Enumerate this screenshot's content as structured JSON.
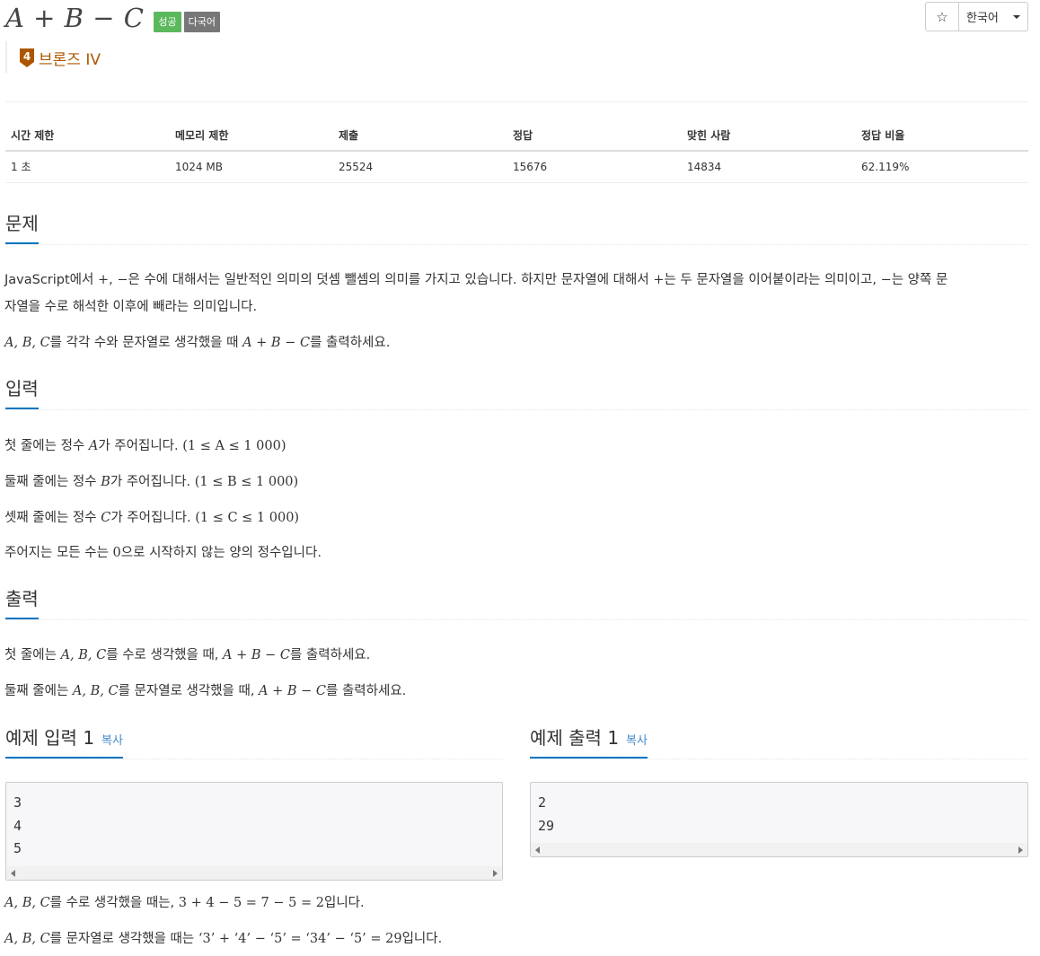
{
  "header": {
    "title": "A + B − C",
    "badges": [
      "성공",
      "다국어"
    ],
    "star_icon": "☆",
    "language": "한국어",
    "tier_number": "4",
    "tier_label": "브론즈 IV",
    "tier_color": "#ad5600"
  },
  "info": {
    "headers": [
      "시간 제한",
      "메모리 제한",
      "제출",
      "정답",
      "맞힌 사람",
      "정답 비율"
    ],
    "values": [
      "1 초",
      "1024 MB",
      "25524",
      "15676",
      "14834",
      "62.119%"
    ]
  },
  "problem": {
    "heading": "문제",
    "p1_a": "JavaScript에서 ",
    "p1_plus": "+",
    "p1_b": ", ",
    "p1_minus": "−",
    "p1_c": "은 수에 대해서는 일반적인 의미의 덧셈 뺄셈의 의미를 가지고 있습니다. 하지만 문자열에 대해서 ",
    "p1_plus2": "+",
    "p1_d": "는 두 문자열을 이어붙이라는 의미이고, ",
    "p1_minus2": "−",
    "p1_e": "는 양쪽 문",
    "p1_line2": "자열을 수로 해석한 이후에 빼라는 의미입니다.",
    "p2_vars": "A, B, C",
    "p2_a": "를 각각 수와 문자열로 생각했을 때 ",
    "p2_expr": "A + B − C",
    "p2_b": "를 출력하세요."
  },
  "input": {
    "heading": "입력",
    "l1_a": "첫 줄에는 정수 ",
    "l1_var": "A",
    "l1_b": "가 주어집니다. ",
    "l1_range": "(1 ≤ A ≤ 1 000)",
    "l2_a": "둘째 줄에는 정수 ",
    "l2_var": "B",
    "l2_b": "가 주어집니다. ",
    "l2_range": "(1 ≤ B ≤ 1 000)",
    "l3_a": "셋째 줄에는 정수 ",
    "l3_var": "C",
    "l3_b": "가 주어집니다. ",
    "l3_range": "(1 ≤ C ≤ 1 000)",
    "l4_a": "주어지는 모든 수는 ",
    "l4_zero": "0",
    "l4_b": "으로 시작하지 않는 양의 정수입니다."
  },
  "output": {
    "heading": "출력",
    "l1_a": "첫 줄에는 ",
    "l1_vars": "A, B, C",
    "l1_b": "를 수로 생각했을 때, ",
    "l1_expr": "A + B − C",
    "l1_c": "를 출력하세요.",
    "l2_a": "둘째 줄에는 ",
    "l2_vars": "A, B, C",
    "l2_b": "를 문자열로 생각했을 때, ",
    "l2_expr": "A + B − C",
    "l2_c": "를 출력하세요."
  },
  "samples": {
    "input_heading": "예제 입력 1",
    "output_heading": "예제 출력 1",
    "copy_label": "복사",
    "input_text": "3\n4\n5",
    "output_text": "2\n29"
  },
  "explanation": {
    "l1_vars": "A, B, C",
    "l1_a": "를 수로 생각했을 때는, ",
    "l1_expr": "3 + 4 − 5 = 7 − 5 = 2",
    "l1_b": "입니다.",
    "l2_vars": "A, B, C",
    "l2_a": "를 문자열로 생각했을 때는 ",
    "l2_expr": "‘3’ + ‘4’ − ‘5’ = ‘34’ − ‘5’ = 29",
    "l2_b": "입니다."
  }
}
